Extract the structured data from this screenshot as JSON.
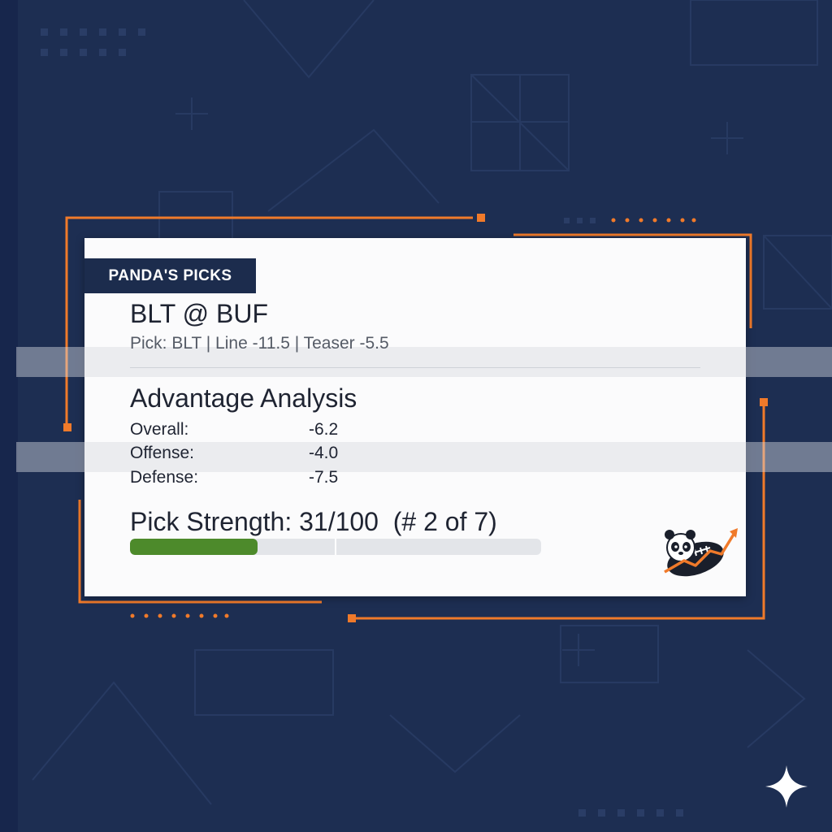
{
  "brand": {
    "tag": "PANDA'S PICKS"
  },
  "game": {
    "matchup": "BLT @ BUF",
    "pick_line": "Pick: BLT | Line -11.5 | Teaser -5.5"
  },
  "analysis": {
    "title": "Advantage Analysis",
    "metrics": [
      {
        "label": "Overall:",
        "value": "-6.2"
      },
      {
        "label": "Offense:",
        "value": "-4.0"
      },
      {
        "label": "Defense:",
        "value": "-7.5"
      }
    ]
  },
  "strength": {
    "text": "Pick Strength: 31/100  (# 2 of 7)",
    "progress_fraction": 0.31
  },
  "colors": {
    "background": "#1d2e52",
    "accent_orange": "#f07a2a",
    "navy_tag": "#1c2c4d",
    "progress_green": "#4d8a2b"
  },
  "icons": {
    "logo": "panda-football-logo-icon",
    "sparkle": "sparkle-icon"
  }
}
